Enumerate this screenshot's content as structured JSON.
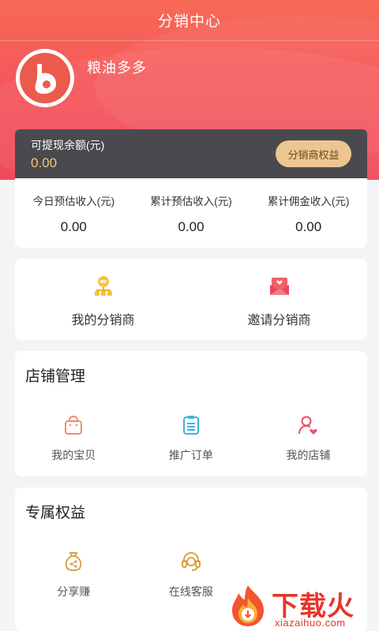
{
  "header": {
    "title": "分销中心"
  },
  "user": {
    "name": "粮油多多"
  },
  "balance": {
    "label": "可提现余额(元)",
    "value": "0.00",
    "rights_button": "分销商权益"
  },
  "stats": [
    {
      "label": "今日预估收入(元)",
      "value": "0.00"
    },
    {
      "label": "累计预估收入(元)",
      "value": "0.00"
    },
    {
      "label": "累计佣金收入(元)",
      "value": "0.00"
    }
  ],
  "distributors": {
    "my": {
      "label": "我的分销商",
      "icon": "distributor-icon"
    },
    "invite": {
      "label": "邀请分销商",
      "icon": "invite-envelope-icon"
    }
  },
  "shop_management": {
    "title": "店铺管理",
    "items": [
      {
        "label": "我的宝贝",
        "icon": "shopping-bag-icon"
      },
      {
        "label": "推广订单",
        "icon": "order-list-icon"
      },
      {
        "label": "我的店铺",
        "icon": "user-heart-icon"
      }
    ]
  },
  "exclusive_rights": {
    "title": "专属权益",
    "items": [
      {
        "label": "分享赚",
        "icon": "money-bag-share-icon"
      },
      {
        "label": "在线客服",
        "icon": "headset-icon"
      }
    ]
  },
  "watermark": {
    "brand": "下载火",
    "url": "xiazaihuo.com"
  },
  "colors": {
    "accent": "#f5575a",
    "gold": "#ecc690",
    "balance_bg": "#4a4a4e"
  }
}
